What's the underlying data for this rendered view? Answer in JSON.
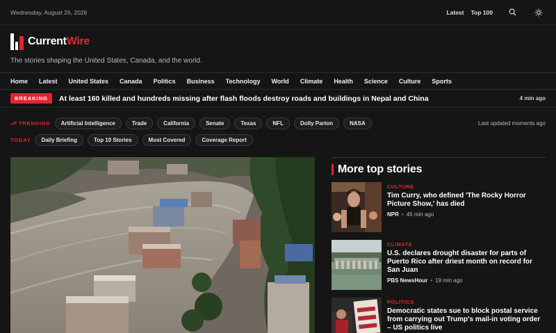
{
  "topbar": {
    "date": "Wednesday, August 26, 2026",
    "links": [
      "Latest",
      "Top 100"
    ],
    "icons": [
      "search-icon",
      "theme-toggle-icon"
    ]
  },
  "brand": {
    "name_part1": "Current",
    "name_part2": "Wire",
    "tagline": "The stories shaping the United States, Canada, and the world.",
    "accent": "#e0262f"
  },
  "nav": [
    "Home",
    "Latest",
    "United States",
    "Canada",
    "Politics",
    "Business",
    "Technology",
    "World",
    "Climate",
    "Health",
    "Science",
    "Culture",
    "Sports"
  ],
  "breaking": {
    "label": "BREAKING",
    "headline": "At least 160 killed and hundreds missing after flash floods destroy roads and buildings in Nepal and China",
    "time": "4 min ago"
  },
  "trending": {
    "label": "TRENDING",
    "chips": [
      "Artificial Intelligence",
      "Trade",
      "California",
      "Senate",
      "Texas",
      "NFL",
      "Dolly Parton",
      "NASA"
    ],
    "updated": "Last updated moments ago"
  },
  "today": {
    "label": "TODAY",
    "chips": [
      "Daily Briefing",
      "Top 10 Stories",
      "Most Covered",
      "Coverage Report"
    ]
  },
  "more_stories": {
    "title": "More top stories",
    "items": [
      {
        "category": "CULTURE",
        "headline": "Tim Curry, who defined 'The Rocky Horror Picture Show,' has died",
        "source": "NPR",
        "time": "46 min ago"
      },
      {
        "category": "CLIMATE",
        "headline": "U.S. declares drought disaster for parts of Puerto Rico after driest month on record for San Juan",
        "source": "PBS NewsHour",
        "time": "19 min ago"
      },
      {
        "category": "POLITICS",
        "headline": "Democratic states sue to block postal service from carrying out Trump's mail-in voting order – US politics live",
        "source": "",
        "time": ""
      }
    ]
  }
}
